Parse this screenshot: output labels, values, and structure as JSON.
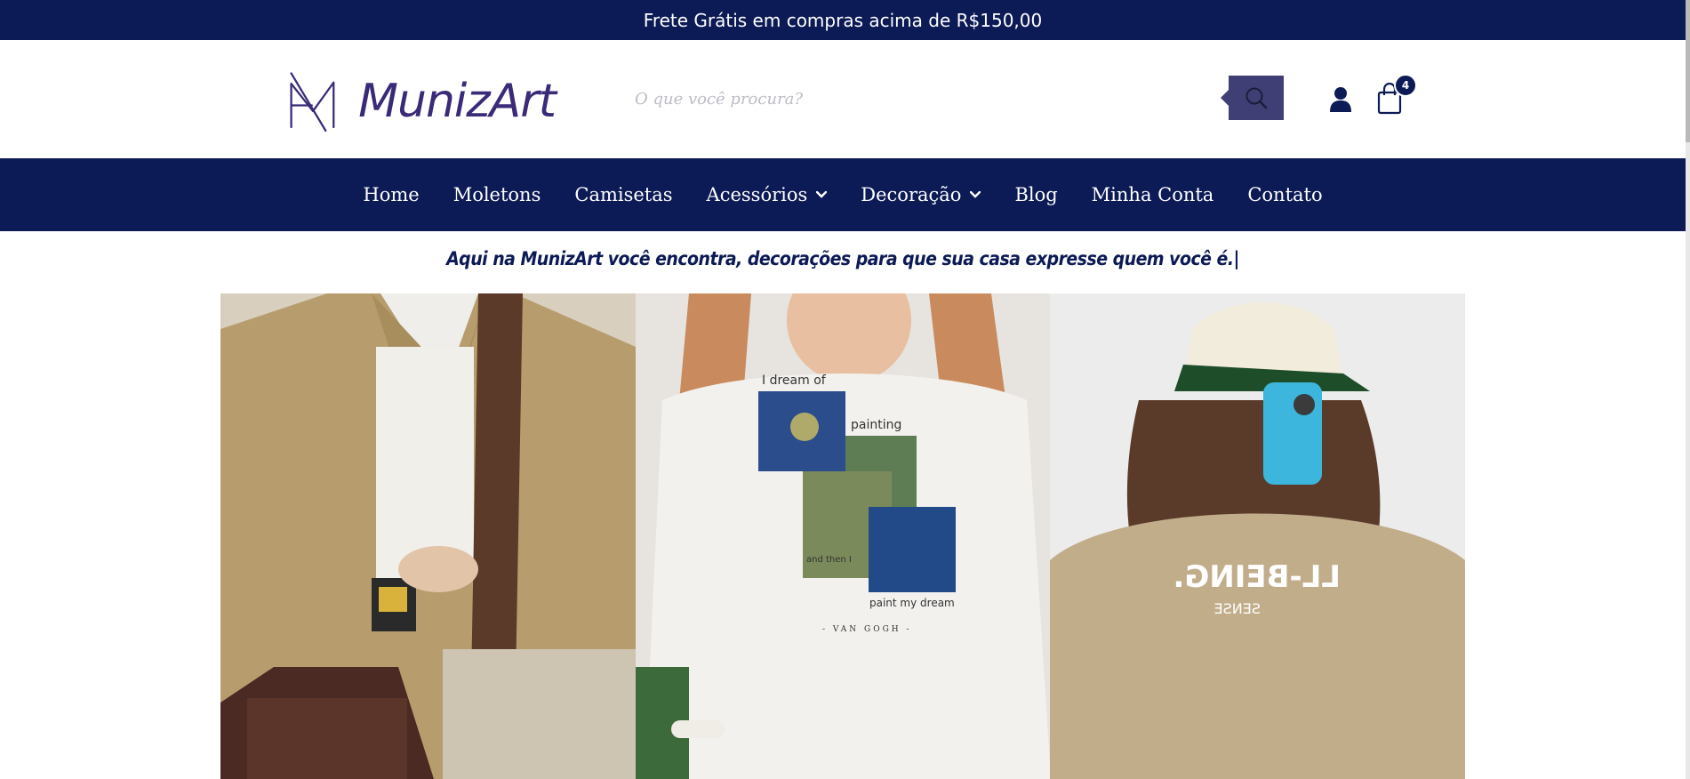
{
  "promo_bar": {
    "text": "Frete Grátis em compras acima de R$150,00"
  },
  "header": {
    "logo_text": "MunizArt",
    "search_placeholder": "O que você procura?",
    "cart_count": "4",
    "icons": {
      "search": "search-icon",
      "user": "user-icon",
      "cart": "shopping-bag-icon"
    }
  },
  "nav": {
    "items": [
      {
        "label": "Home",
        "dropdown": false
      },
      {
        "label": "Moletons",
        "dropdown": false
      },
      {
        "label": "Camisetas",
        "dropdown": false
      },
      {
        "label": "Acessórios",
        "dropdown": true
      },
      {
        "label": "Decoração",
        "dropdown": true
      },
      {
        "label": "Blog",
        "dropdown": false
      },
      {
        "label": "Minha Conta",
        "dropdown": false
      },
      {
        "label": "Contato",
        "dropdown": false
      }
    ]
  },
  "tagline": "Aqui na MunizArt você encontra, decorações para que sua casa expresse quem você é.|",
  "gallery": {
    "t1": {
      "alt": "",
      "print": ""
    },
    "t2": {
      "print_lines": [
        "I dream of",
        "painting",
        "and then I",
        "paint my dream",
        "- VAN GOGH -"
      ]
    },
    "t3": {
      "print_line1": "LL-BEING.",
      "print_line2": "SENSE"
    }
  },
  "colors": {
    "navy": "#0c1a55",
    "brand_purple": "#3a2a78",
    "search_button": "#3f3f75"
  }
}
